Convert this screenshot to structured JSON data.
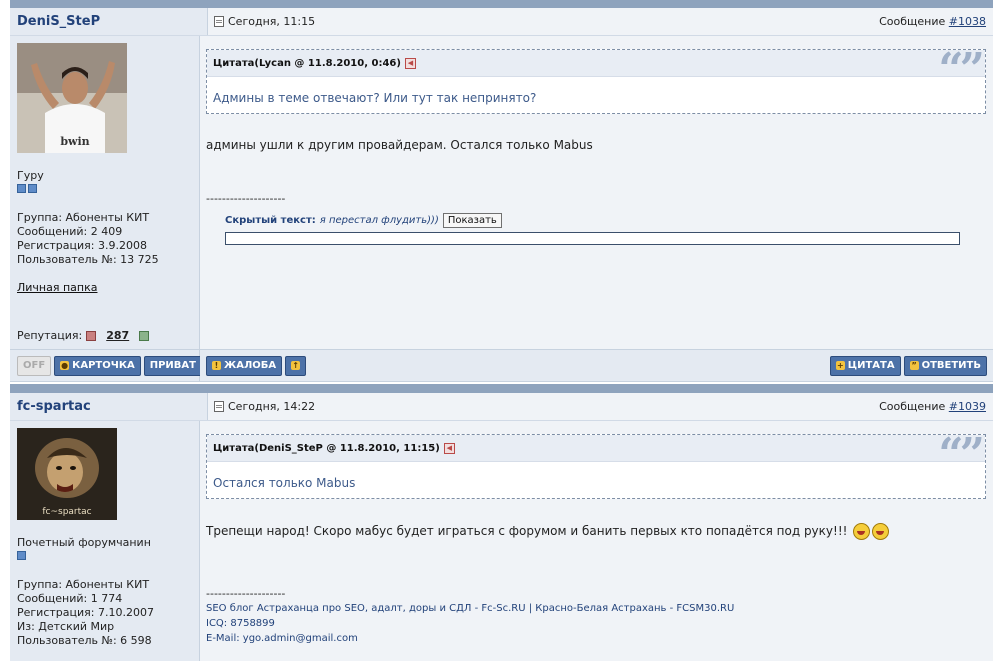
{
  "posts": [
    {
      "author": "DeniS_SteP",
      "date": "Сегодня, 11:15",
      "msg_prefix": "Сообщение",
      "msg_num": "#1038",
      "rank": "Гуру",
      "info": [
        "Группа: Абоненты КИТ",
        "Сообщений: 2 409",
        "Регистрация: 3.9.2008",
        "Пользователь №: 13 725"
      ],
      "folder": "Личная папка",
      "rep_label": "Репутация:",
      "rep_value": "287",
      "quote_head": "Цитата(Lycan @ 11.8.2010, 0:46)",
      "quote_text": "Админы в теме отвечают? Или тут так непринято?",
      "message": "админы ушли к другим провайдерам. Остался только Mabus",
      "sig_dash": "--------------------",
      "hidden_label": "Скрытый текст:",
      "hidden_text": "я перестал флудить)))",
      "show_btn": "Показать"
    },
    {
      "author": "fc-spartac",
      "date": "Сегодня, 14:22",
      "msg_prefix": "Сообщение",
      "msg_num": "#1039",
      "rank": "Почетный форумчанин",
      "avatar_text": "fc~spartac",
      "info": [
        "Группа: Абоненты КИТ",
        "Сообщений: 1 774",
        "Регистрация: 7.10.2007",
        "Из: Детский Мир",
        "Пользователь №: 6 598"
      ],
      "quote_head": "Цитата(DeniS_SteP @ 11.8.2010, 11:15)",
      "quote_text": "Остался только Mabus",
      "message": "Трепещи народ! Скоро мабус будет играться с форумом и банить первых кто попадётся под руку!!!",
      "sig_dash": "--------------------",
      "sig_lines": [
        "SEO блог Астраханца про SEO, адалт, доры и СДЛ - Fc-Sc.RU | Красно-Белая Астрахань - FCSM30.RU",
        "ICQ: 8758899",
        "E-Mail: ygo.admin@gmail.com"
      ]
    }
  ],
  "actions": {
    "off": "OFF",
    "card": "КАРТОЧКА",
    "private": "ПРИВАТ",
    "complaint": "ЖАЛОБА",
    "quote": "ЦИТАТА",
    "reply": "ОТВЕТИТЬ"
  }
}
